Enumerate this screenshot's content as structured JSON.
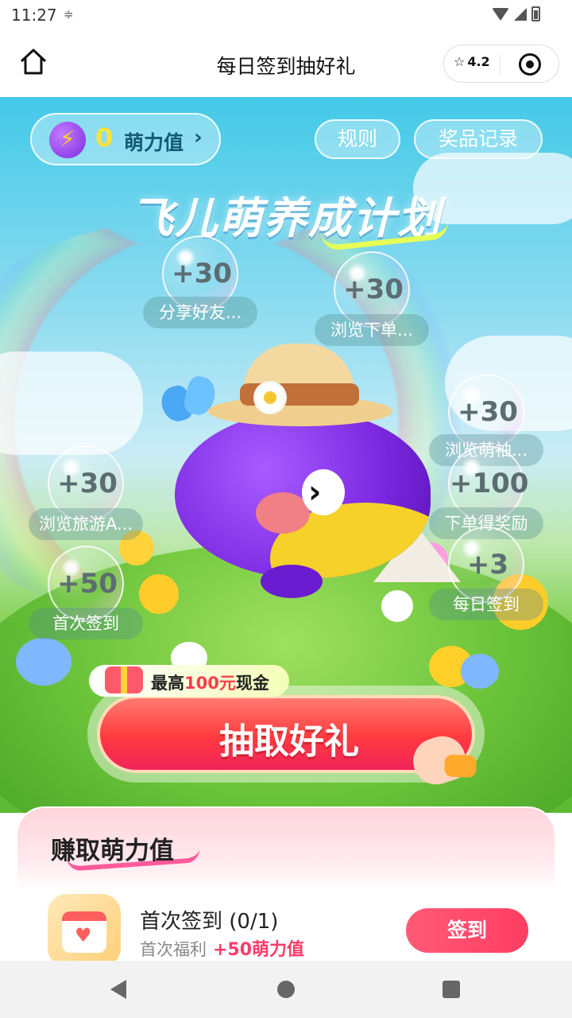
{
  "status_bar": {
    "time": "11:27",
    "settings_icon": "sliders-icon"
  },
  "title_bar": {
    "title": "每日签到抽好礼",
    "rating": "4.2"
  },
  "hero": {
    "coin_value": "0",
    "coin_label": "萌力值",
    "coin_arrow": "›",
    "rules_label": "规则",
    "records_label": "奖品记录",
    "title": "飞儿萌养成计划",
    "bubbles": [
      {
        "value": "+30",
        "label": "分享好友..."
      },
      {
        "value": "+30",
        "label": "浏览下单..."
      },
      {
        "value": "+30",
        "label": "浏览旅游A..."
      },
      {
        "value": "+50",
        "label": "首次签到"
      },
      {
        "value": "+30",
        "label": "浏览萌袖..."
      },
      {
        "value": "+100",
        "label": "下单得奖励"
      },
      {
        "value": "+3",
        "label": "每日签到"
      }
    ],
    "promo_prefix": "最高",
    "promo_amount": "100元",
    "promo_suffix": "现金",
    "draw_label": "抽取好礼"
  },
  "earn": {
    "title": "赚取萌力值",
    "task_name": "首次签到 (0/1)",
    "task_sub": "首次福利",
    "task_reward": "+50萌力值",
    "task_button": "签到"
  },
  "colors": {
    "accent": "#ff3d63",
    "coin": "#ffe23a",
    "sky": "#43c9e8",
    "grass": "#5cb932"
  }
}
